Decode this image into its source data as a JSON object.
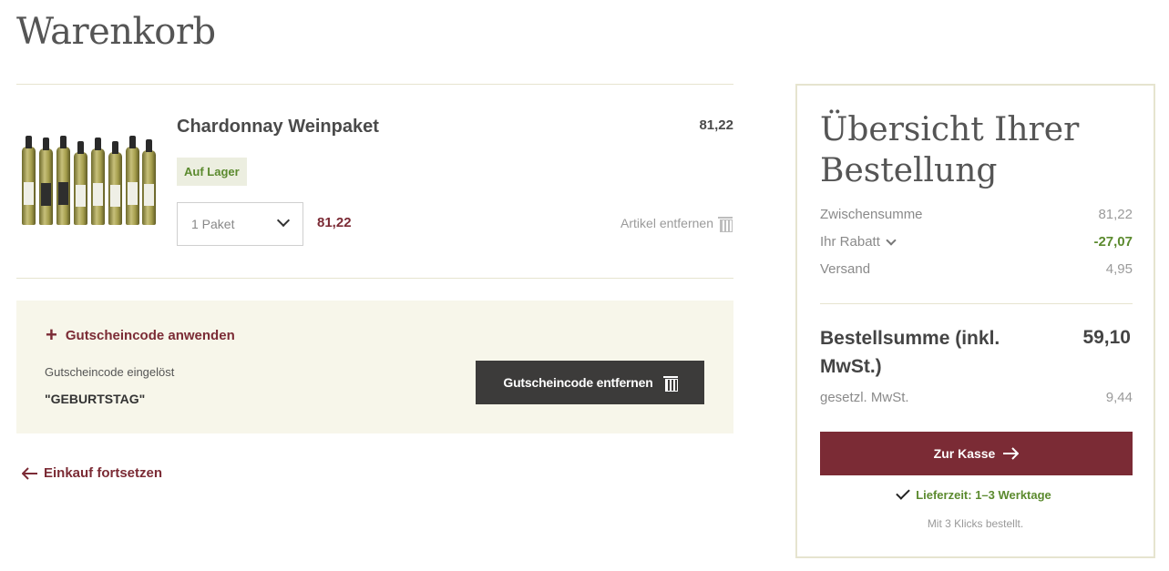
{
  "page": {
    "title": "Warenkorb"
  },
  "cart": {
    "items": [
      {
        "name": "Chardonnay Weinpaket",
        "price_top": "81,22",
        "stock_badge": "Auf Lager",
        "quantity_selected": "1 Paket",
        "line_price": "81,22",
        "remove_label": "Artikel entfernen"
      }
    ]
  },
  "coupon": {
    "apply_label": "Gutscheincode anwenden",
    "applied_label": "Gutscheincode eingelöst",
    "code": "\"GEBURTSTAG\"",
    "remove_button": "Gutscheincode entfernen"
  },
  "continue_label": "Einkauf fortsetzen",
  "summary": {
    "title": "Übersicht Ihrer Bestellung",
    "subtotal_label": "Zwischensumme",
    "subtotal_value": "81,22",
    "discount_label": "Ihr Rabatt",
    "discount_value": "-27,07",
    "shipping_label": "Versand",
    "shipping_value": "4,95",
    "total_label": "Bestellsumme (inkl. MwSt.)",
    "total_value": "59,10",
    "vat_label": "gesetzl. MwSt.",
    "vat_value": "9,44",
    "checkout_button": "Zur Kasse",
    "delivery_text": "Lieferzeit: 1–3 Werktage",
    "clicks_text": "Mit 3 Klicks bestellt."
  },
  "colors": {
    "accent": "#7b2b35",
    "success": "#5b8a2e",
    "dark_button": "#3c3b3a",
    "coupon_bg": "#f7f6ea",
    "border": "#e6e4cf"
  },
  "icons": [
    "plus-icon",
    "trash-icon",
    "chevron-down-icon",
    "arrow-left-icon",
    "arrow-right-icon",
    "check-icon"
  ]
}
